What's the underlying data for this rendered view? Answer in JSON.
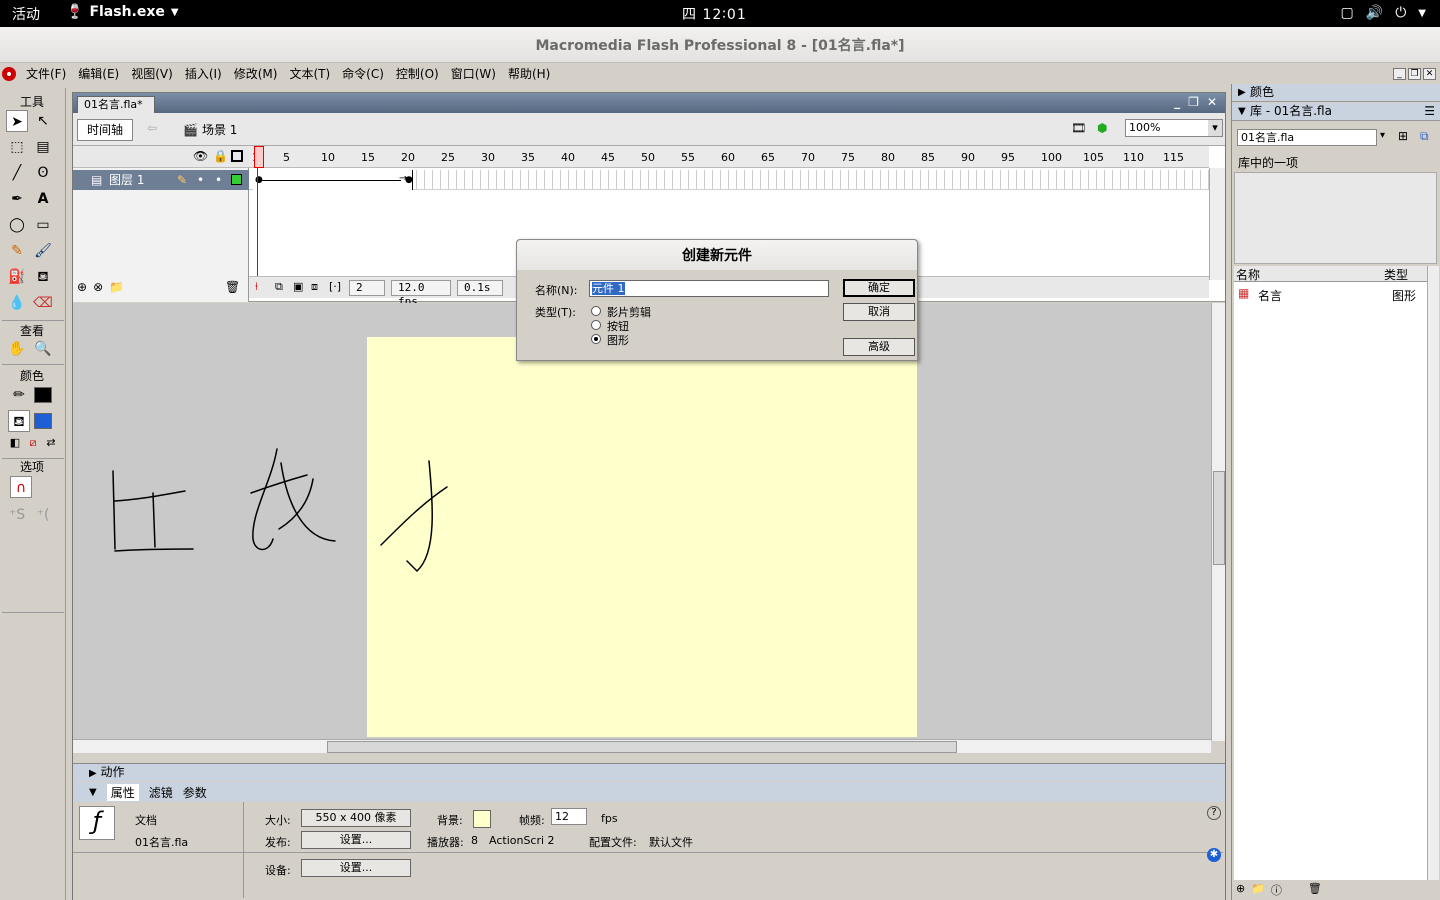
{
  "topbar": {
    "activities": "活动",
    "app_name": "Flash.exe",
    "clock": "四 12∶01"
  },
  "window": {
    "title": "Macromedia Flash Professional 8 - [01名言.fla*]"
  },
  "menu": {
    "items": [
      "文件(F)",
      "编辑(E)",
      "视图(V)",
      "插入(I)",
      "修改(M)",
      "文本(T)",
      "命令(C)",
      "控制(O)",
      "窗口(W)",
      "帮助(H)"
    ]
  },
  "tools": {
    "header": "工具",
    "view_header": "查看",
    "colors_header": "颜色",
    "options_header": "选项"
  },
  "document": {
    "tab": "01名言.fla*",
    "timeline_button": "时间轴",
    "scene": "场景 1",
    "zoom": "100%"
  },
  "timeline": {
    "layer_name": "图层 1",
    "ruler": [
      "1",
      "5",
      "10",
      "15",
      "20",
      "25",
      "30",
      "35",
      "40",
      "45",
      "50",
      "55",
      "60",
      "65",
      "70",
      "75",
      "80",
      "85",
      "90",
      "95",
      "100",
      "105",
      "110",
      "115"
    ],
    "current_frame": "2",
    "fps": "12.0 fps",
    "time": "0.1s"
  },
  "stage": {
    "background": "#ffffcc"
  },
  "panels": {
    "actions": "动作",
    "tabs": [
      "属性",
      "滤镜",
      "参数"
    ]
  },
  "properties": {
    "doc_label": "文档",
    "doc_file": "01名言.fla",
    "size_label": "大小:",
    "size_value": "550 x 400 像素",
    "bg_label": "背景:",
    "framerate_label": "帧频:",
    "framerate_value": "12",
    "fps_unit": "fps",
    "publish_label": "发布:",
    "settings_button": "设置...",
    "player_label": "播放器:",
    "player_value": "8",
    "actionscript": "ActionScri 2",
    "profile_label": "配置文件:",
    "profile_value": "默认文件",
    "device_label": "设备:",
    "device_button": "设置..."
  },
  "right": {
    "color_panel": "颜色",
    "library_panel": "库 - 01名言.fla",
    "library_select": "01名言.fla",
    "item_count": "库中的一项",
    "col_name": "名称",
    "col_type": "类型",
    "item_name": "名言",
    "item_type": "图形"
  },
  "dialog": {
    "title": "创建新元件",
    "name_label": "名称(N):",
    "name_value": "元件 1",
    "type_label": "类型(T):",
    "types": [
      "影片剪辑",
      "按钮",
      "图形"
    ],
    "ok": "确定",
    "cancel": "取消",
    "advanced": "高级"
  }
}
